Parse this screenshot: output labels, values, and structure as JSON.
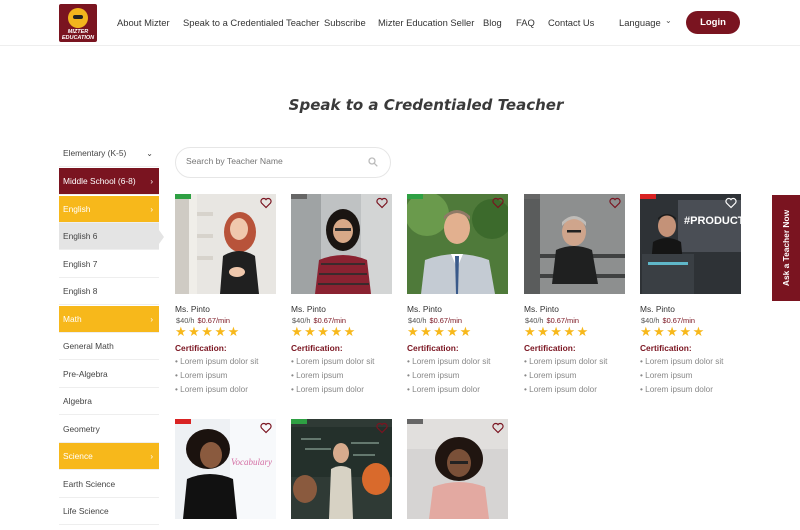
{
  "logo": {
    "text_line1": "MIZTER",
    "text_line2": "EDUCATION"
  },
  "nav": {
    "items": [
      "About Mizter",
      "Speak to a Credentialed Teacher",
      "Subscribe",
      "Mizter Education Seller",
      "Blog",
      "FAQ",
      "Contact Us"
    ],
    "language_label": "Language",
    "login_label": "Login"
  },
  "page": {
    "title": "Speak to a Credentialed Teacher"
  },
  "search": {
    "placeholder": "Search by Teacher Name"
  },
  "sidebar": {
    "items": [
      {
        "label": "Elementary (K-5)",
        "chevron": "⌄"
      },
      {
        "label": "Middle School (6-8)",
        "chevron": "›"
      },
      {
        "label": "English",
        "chevron": "›"
      },
      {
        "label": "English 6",
        "chevron": ""
      },
      {
        "label": "English 7",
        "chevron": ""
      },
      {
        "label": "English 8",
        "chevron": ""
      },
      {
        "label": "Math",
        "chevron": "›"
      },
      {
        "label": "General Math",
        "chevron": ""
      },
      {
        "label": "Pre-Algebra",
        "chevron": ""
      },
      {
        "label": "Algebra",
        "chevron": ""
      },
      {
        "label": "Geometry",
        "chevron": ""
      },
      {
        "label": "Science",
        "chevron": "›"
      },
      {
        "label": "Earth Science",
        "chevron": ""
      },
      {
        "label": "Life Science",
        "chevron": ""
      }
    ]
  },
  "teachers": [
    {
      "name": "Ms. Pinto",
      "rate_hour": "$40/h",
      "rate_min": "$0.67/min",
      "stars": "★★★★★",
      "cert_label": "Certification:",
      "certs": [
        "Lorem ipsum dolor sit",
        "Lorem ipsum",
        "Lorem ipsum dolor"
      ],
      "status_color": "#2ea043",
      "photo": "woman-redhead-bookshelf"
    },
    {
      "name": "Ms. Pinto",
      "rate_hour": "$40/h",
      "rate_min": "$0.67/min",
      "stars": "★★★★★",
      "cert_label": "Certification:",
      "certs": [
        "Lorem ipsum dolor sit",
        "Lorem ipsum",
        "Lorem ipsum dolor"
      ],
      "status_color": "#666666",
      "photo": "woman-glasses-plaid"
    },
    {
      "name": "Ms. Pinto",
      "rate_hour": "$40/h",
      "rate_min": "$0.67/min",
      "stars": "★★★★★",
      "cert_label": "Certification:",
      "certs": [
        "Lorem ipsum dolor sit",
        "Lorem ipsum",
        "Lorem ipsum dolor"
      ],
      "status_color": "#2ea043",
      "photo": "man-suit-outdoor"
    },
    {
      "name": "Ms. Pinto",
      "rate_hour": "$40/h",
      "rate_min": "$0.67/min",
      "stars": "★★★★★",
      "cert_label": "Certification:",
      "certs": [
        "Lorem ipsum dolor sit",
        "Lorem ipsum",
        "Lorem ipsum dolor"
      ],
      "status_color": "#666666",
      "photo": "woman-seated-grey"
    },
    {
      "name": "Ms. Pinto",
      "rate_hour": "$40/h",
      "rate_min": "$0.67/min",
      "stars": "★★★★★",
      "cert_label": "Certification:",
      "certs": [
        "Lorem ipsum dolor sit",
        "Lorem ipsum",
        "Lorem ipsum dolor"
      ],
      "status_color": "#d92323",
      "photo": "man-podium-screen",
      "screen_text": "#PRODUCTC"
    },
    {
      "name": "",
      "status_color": "#d92323",
      "photo": "woman-whiteboard",
      "board_text": "Vocabulary"
    },
    {
      "name": "",
      "status_color": "#2ea043",
      "photo": "man-chalkboard"
    },
    {
      "name": "",
      "status_color": "#666666",
      "photo": "woman-glasses-curly"
    }
  ],
  "side_tab": {
    "label": "Ask a Teacher Now"
  },
  "colors": {
    "brand": "#7a1420",
    "accent": "#f7b81b",
    "grey": "#e4e4e4"
  }
}
